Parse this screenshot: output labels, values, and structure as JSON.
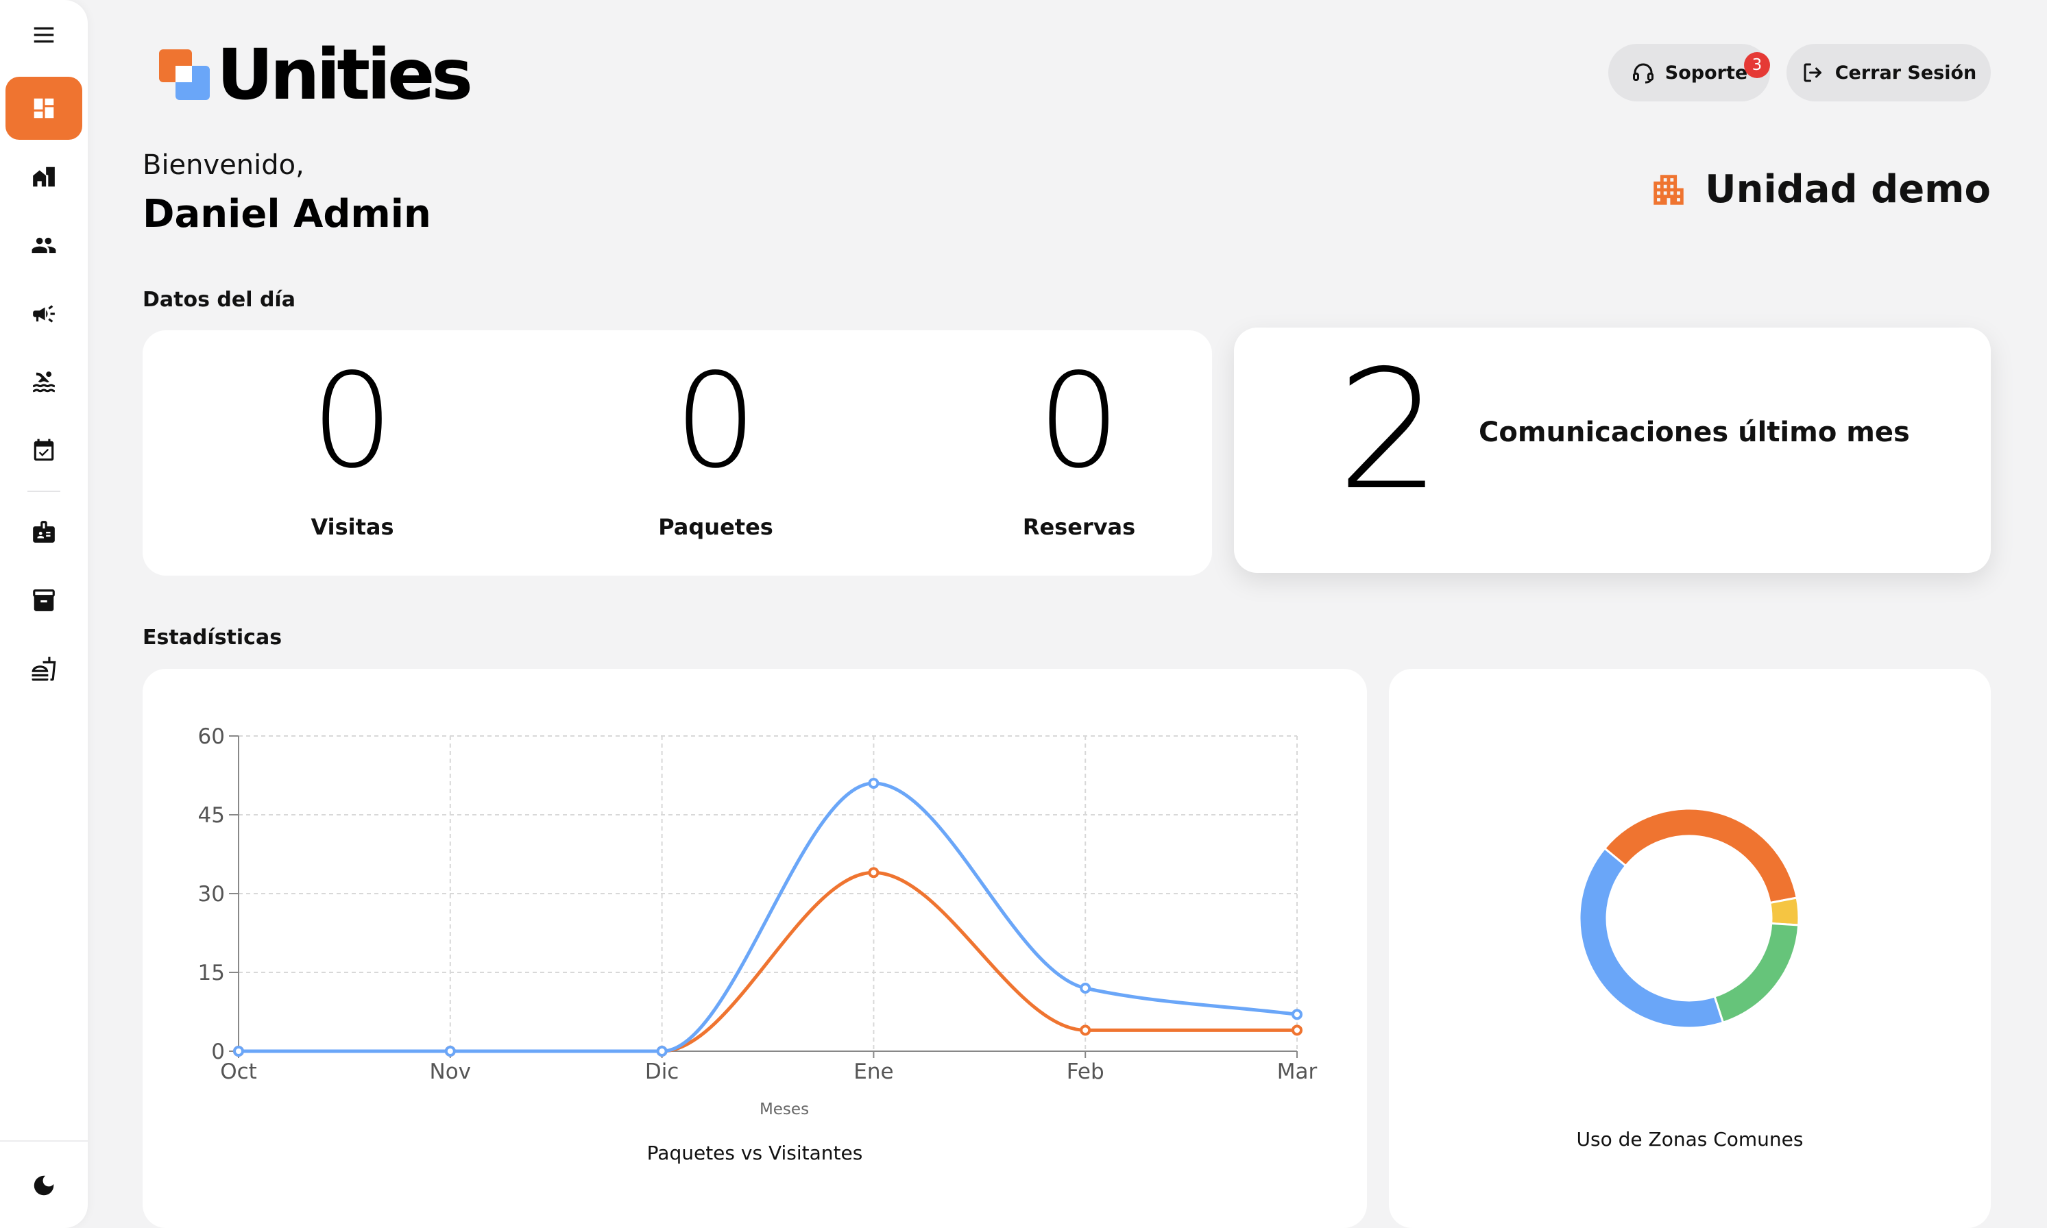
{
  "app": {
    "logo_text": "Unities"
  },
  "header": {
    "support_label": "Soporte",
    "support_badge": "3",
    "logout_label": "Cerrar Sesión",
    "greeting": "Bienvenido,",
    "user_name": "Daniel Admin",
    "unit_name": "Unidad demo"
  },
  "sidebar": {
    "items": [
      {
        "icon": "dashboard-icon",
        "active": true
      },
      {
        "icon": "building-home-icon"
      },
      {
        "icon": "people-icon"
      },
      {
        "icon": "megaphone-icon"
      },
      {
        "icon": "pool-icon"
      },
      {
        "icon": "calendar-check-icon"
      },
      {
        "icon": "id-card-icon"
      },
      {
        "icon": "archive-box-icon"
      },
      {
        "icon": "food-service-icon"
      }
    ],
    "bottom_icon": "moon-icon"
  },
  "daily": {
    "title": "Datos del día",
    "stats": [
      {
        "value": "0",
        "label": "Visitas"
      },
      {
        "value": "0",
        "label": "Paquetes"
      },
      {
        "value": "0",
        "label": "Reservas"
      }
    ],
    "communications": {
      "value": "2",
      "label": "Comunicaciones último mes"
    }
  },
  "stats_section": {
    "title": "Estadísticas"
  },
  "colors": {
    "accent": "#ef7430",
    "blue": "#6aa6f8",
    "green": "#66c47a",
    "yellow": "#f5c542"
  },
  "chart_data": [
    {
      "type": "line",
      "title": "Paquetes vs Visitantes",
      "xlabel": "Meses",
      "ylabel": "",
      "categories": [
        "Oct",
        "Nov",
        "Dic",
        "Ene",
        "Feb",
        "Mar"
      ],
      "ylim": [
        0,
        60
      ],
      "yticks": [
        0,
        15,
        30,
        45,
        60
      ],
      "grid": true,
      "series": [
        {
          "values": [
            0,
            0,
            0,
            51,
            12,
            7
          ],
          "color": "#6aa6f8"
        },
        {
          "values": [
            0,
            0,
            0,
            34,
            4,
            4
          ],
          "color": "#ef7430"
        }
      ]
    },
    {
      "type": "pie",
      "title": "Uso de Zonas Comunes",
      "values": [
        36,
        4,
        19,
        41
      ],
      "colors": [
        "#ef7430",
        "#f5c542",
        "#66c47a",
        "#6aa6f8"
      ]
    }
  ]
}
